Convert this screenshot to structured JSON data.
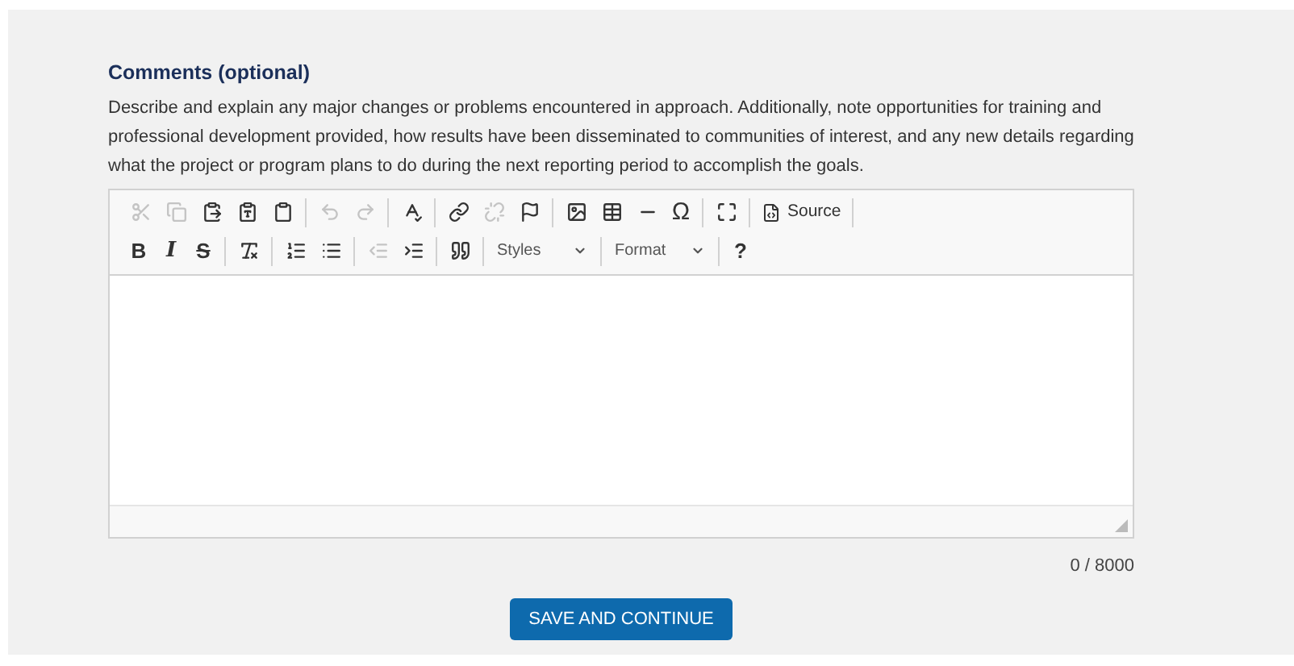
{
  "field": {
    "label": "Comments (optional)",
    "description": "Describe and explain any major changes or problems encountered in approach. Additionally, note opportunities for training and professional development provided, how results have been disseminated to communities of interest, and any new details regarding what the project or program plans to do during the next reporting period to accomplish the goals."
  },
  "toolbar_rows": [
    [
      {
        "kind": "icon",
        "disabled": true
      },
      {
        "kind": "icon",
        "disabled": true
      },
      {
        "kind": "icon",
        "disabled": false
      },
      {
        "kind": "icon",
        "disabled": false
      },
      {
        "kind": "icon",
        "disabled": false
      },
      {
        "kind": "separator"
      },
      {
        "kind": "icon",
        "disabled": true
      },
      {
        "kind": "icon",
        "disabled": true
      },
      {
        "kind": "separator"
      },
      {
        "kind": "icon",
        "disabled": false
      },
      {
        "kind": "separator"
      },
      {
        "kind": "icon",
        "disabled": false
      },
      {
        "kind": "icon",
        "disabled": true
      },
      {
        "kind": "icon",
        "disabled": false
      },
      {
        "kind": "separator"
      },
      {
        "kind": "icon",
        "disabled": false
      },
      {
        "kind": "icon",
        "disabled": false
      },
      {
        "kind": "icon",
        "disabled": false
      },
      {
        "kind": "symbol",
        "text": "Ω"
      },
      {
        "kind": "separator"
      },
      {
        "kind": "icon",
        "disabled": false
      },
      {
        "kind": "separator"
      },
      {
        "kind": "source",
        "text": "Source"
      },
      {
        "kind": "separator"
      }
    ],
    [
      {
        "kind": "bold",
        "text": "B"
      },
      {
        "kind": "italic",
        "text": "I"
      },
      {
        "kind": "strike",
        "text": "S"
      },
      {
        "kind": "separator"
      },
      {
        "kind": "icon",
        "disabled": false
      },
      {
        "kind": "separator"
      },
      {
        "kind": "icon",
        "disabled": false
      },
      {
        "kind": "icon",
        "disabled": false
      },
      {
        "kind": "separator"
      },
      {
        "kind": "icon",
        "disabled": true
      },
      {
        "kind": "icon",
        "disabled": false
      },
      {
        "kind": "separator"
      },
      {
        "kind": "icon",
        "disabled": false
      },
      {
        "kind": "separator"
      },
      {
        "kind": "combo",
        "text": "Styles"
      },
      {
        "kind": "separator"
      },
      {
        "kind": "combo",
        "text": "Format"
      },
      {
        "kind": "separator"
      },
      {
        "kind": "bold",
        "text": "?"
      }
    ]
  ],
  "counter": "0 / 8000",
  "submit": "SAVE AND CONTINUE"
}
